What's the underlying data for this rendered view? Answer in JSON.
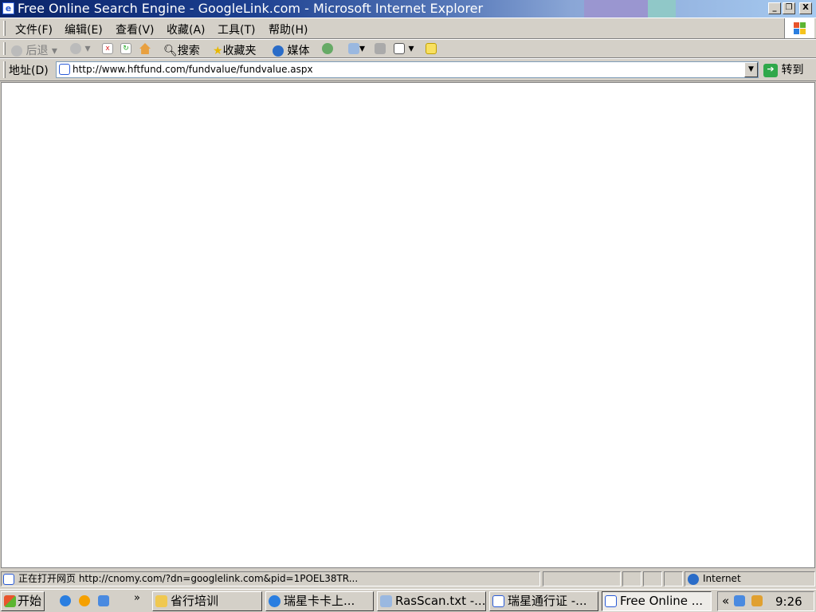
{
  "window": {
    "title": "Free Online Search Engine - GoogleLink.com - Microsoft Internet Explorer"
  },
  "menu": [
    "文件(F)",
    "编辑(E)",
    "查看(V)",
    "收藏(A)",
    "工具(T)",
    "帮助(H)"
  ],
  "toolbar": {
    "back": "后退",
    "search": "搜索",
    "favorites": "收藏夹",
    "media": "媒体"
  },
  "address": {
    "label": "地址(D)",
    "url": "http://www.hftfund.com/fundvalue/fundvalue.aspx",
    "go": "转到"
  },
  "status": {
    "text": "正在打开网页 http://cnomy.com/?dn=googlelink.com&pid=1POEL38TR...",
    "zone": "Internet"
  },
  "taskbar": {
    "start": "开始",
    "more": "»",
    "tasks": [
      "省行培训",
      "瑞星卡卡上...",
      "RasScan.txt -...",
      "瑞星通行证 -...",
      "Free Online ..."
    ],
    "tray_expand": "«",
    "clock": "9:26"
  }
}
